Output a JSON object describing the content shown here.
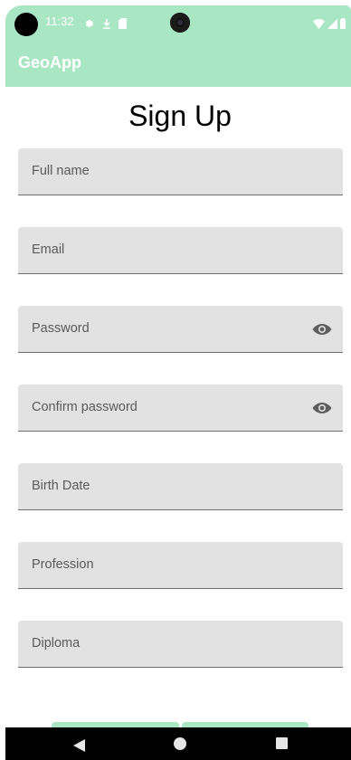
{
  "status_bar": {
    "time": "11:32",
    "left_icons": [
      "gear-icon",
      "download-icon",
      "sd-card-icon"
    ],
    "right_icons": [
      "wifi-icon",
      "signal-icon",
      "battery-icon"
    ],
    "bg_color": "#a9e6c4"
  },
  "app_bar": {
    "title": "GeoApp"
  },
  "page": {
    "title": "Sign Up"
  },
  "form": {
    "fields": [
      {
        "label": "Full name"
      },
      {
        "label": "Email"
      },
      {
        "label": "Password",
        "trailing_icon": "eye-icon"
      },
      {
        "label": "Confirm password",
        "trailing_icon": "eye-icon"
      },
      {
        "label": "Birth Date"
      },
      {
        "label": "Profession"
      },
      {
        "label": "Diploma"
      }
    ],
    "field_bg_color": "#e2e2e2"
  },
  "nav_bar": {
    "icons": [
      "back-icon",
      "home-icon",
      "recents-icon"
    ]
  }
}
